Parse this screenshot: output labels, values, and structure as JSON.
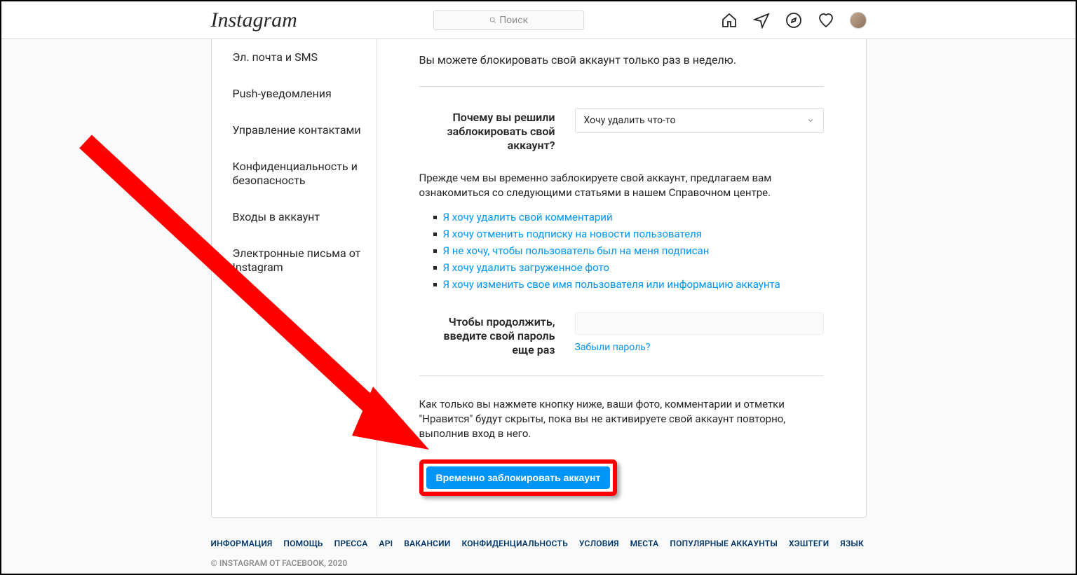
{
  "header": {
    "logo": "Instagram",
    "search_placeholder": "Поиск"
  },
  "sidebar": {
    "items": [
      "Эл. почта и SMS",
      "Push-уведомления",
      "Управление контактами",
      "Конфиденциальность и безопасность",
      "Входы в аккаунт",
      "Электронные письма от Instagram"
    ]
  },
  "main": {
    "limit_note": "Вы можете блокировать свой аккаунт только раз в неделю.",
    "reason_label": "Почему вы решили заблокировать свой аккаунт?",
    "reason_selected": "Хочу удалить что-то",
    "help_intro": "Прежде чем вы временно заблокируете свой аккаунт, предлагаем вам ознакомиться со следующими статьями в нашем Справочном центре.",
    "help_links": [
      "Я хочу удалить свой комментарий",
      "Я хочу отменить подписку на новости пользователя",
      "Я не хочу, чтобы пользователь был на меня подписан",
      "Я хочу удалить загруженное фото",
      "Я хочу изменить свое имя пользователя или информацию аккаунта"
    ],
    "password_label": "Чтобы продолжить, введите свой пароль еще раз",
    "forgot_password": "Забыли пароль?",
    "final_note": "Как только вы нажмете кнопку ниже, ваши фото, комментарии и отметки \"Нравится\" будут скрыты, пока вы не активируете свой аккаунт повторно, выполнив вход в него.",
    "action_button": "Временно заблокировать аккаунт"
  },
  "footer": {
    "links": [
      "ИНФОРМАЦИЯ",
      "ПОМОЩЬ",
      "ПРЕССА",
      "API",
      "ВАКАНСИИ",
      "КОНФИДЕНЦИАЛЬНОСТЬ",
      "УСЛОВИЯ",
      "МЕСТА",
      "ПОПУЛЯРНЫЕ АККАУНТЫ",
      "ХЭШТЕГИ",
      "ЯЗЫК"
    ],
    "copyright": "© INSTAGRAM ОТ FACEBOOK, 2020"
  }
}
